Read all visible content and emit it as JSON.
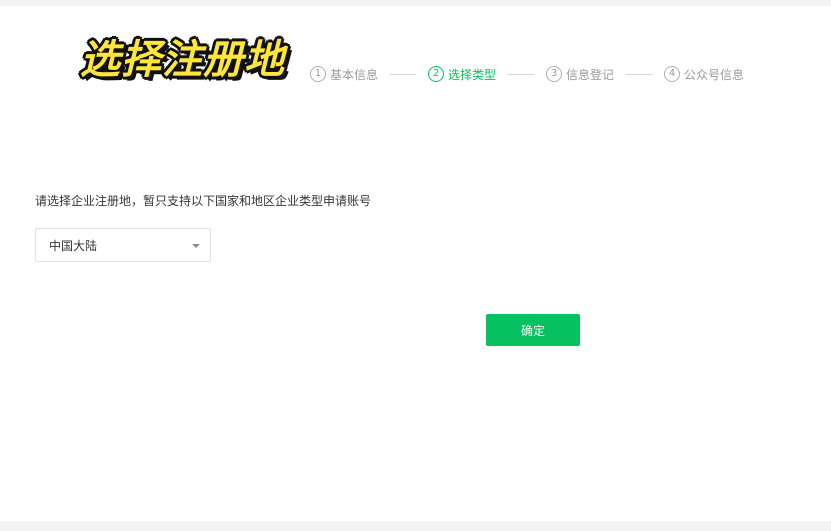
{
  "overlay_title": "选择注册地",
  "steps": [
    {
      "num": "1",
      "label": "基本信息",
      "active": false
    },
    {
      "num": "2",
      "label": "选择类型",
      "active": true
    },
    {
      "num": "3",
      "label": "信息登记",
      "active": false
    },
    {
      "num": "4",
      "label": "公众号信息",
      "active": false
    }
  ],
  "form": {
    "prompt": "请选择企业注册地，暂只支持以下国家和地区企业类型申请账号",
    "region_select": {
      "value": "中国大陆"
    },
    "confirm_label": "确定"
  },
  "colors": {
    "accent": "#07c160",
    "overlay_text": "#ffe63d"
  },
  "icons": {
    "select_caret": "caret-down-icon"
  }
}
